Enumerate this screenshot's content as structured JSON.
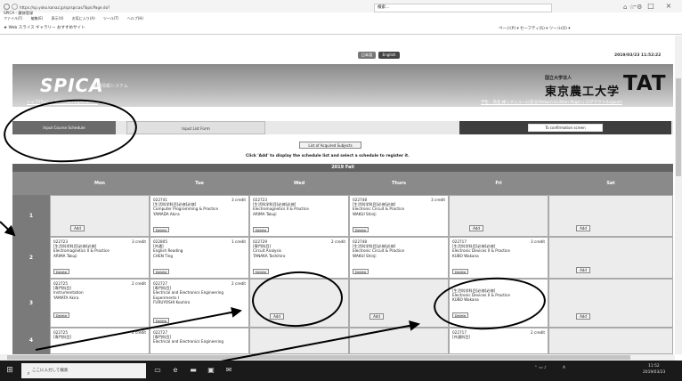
{
  "browser": {
    "url": "https://sp.yoko.kanaz.jp/sp/spicas/TopicPage.do?",
    "tab_title": "SPICA - 履修登録",
    "menu": [
      "ファイル(F)",
      "編集(E)",
      "表示(V)",
      "お気に入り(A)",
      "ツール(T)",
      "ヘルプ(H)"
    ],
    "favorites": [
      "Web スライス ギャラリー",
      "おすすめサイト"
    ],
    "search_placeholder": "検索...",
    "right_tools": "ページ(P) ▾  セーフティ(S) ▾  ツール(O) ▾"
  },
  "page": {
    "lang_jp": "日本語",
    "lang_en": "English",
    "datetime": "2019/03/23 11:52:22",
    "logo": "SPICA",
    "logo_sub": "学務情報システム",
    "uni_small": "国立大学法人",
    "uni_name": "東京農工大学",
    "uni_abbr": "TAT",
    "breadcrumb": "トップ(Top) > 履修登録(Registration)",
    "header_links": "学生 : 氏名 様 | メニューに戻る(Return to Main Page) | ログアウト(Logout)"
  },
  "tabs": {
    "input_schedule": "Input Course Schedule",
    "input_list": "Input List Form",
    "confirm": "To confirmation screen"
  },
  "buttons": {
    "list_subjects": "List of Acquired Subjects",
    "add": "Add",
    "delete": "Delete"
  },
  "instruction": "Click 'Add' to display the schedule list and select a schedule to register it.",
  "term": "2019 Fall",
  "days": [
    "Mon",
    "Tue",
    "Wed",
    "Thurs",
    "Fri",
    "Sat"
  ],
  "periods": [
    "1",
    "2",
    "3",
    "4"
  ],
  "courses": {
    "p1_tue": {
      "code": "022741",
      "credit": "3 credit",
      "req": "[生活科学科目]必修[必修]",
      "title": "Computer Programming & Practice",
      "teacher": "YAMADA Akira"
    },
    "p1_wed": {
      "code": "022723",
      "credit": "",
      "req": "[生活科学科目]必修[必修]",
      "title": "Electromagnetics II & Practice",
      "teacher": "ARIMA Takuji"
    },
    "p1_thu": {
      "code": "022748",
      "credit": "3 credit",
      "req": "[生活科学科目]必修[必修]",
      "title": "Electronic Circuit & Practice",
      "teacher": "WAKUI Shinji"
    },
    "p2_mon": {
      "code": "022723",
      "credit": "3 credit",
      "req": "[生活科学科目]必修[必修]",
      "title": "Electromagnetics II & Practice",
      "teacher": "ARIMA Takuji"
    },
    "p2_tue": {
      "code": "022805",
      "credit": "1 credit",
      "req": "[共通]",
      "title": "English Reading",
      "teacher": "CHEN Ting"
    },
    "p2_wed": {
      "code": "022729",
      "credit": "2 credit",
      "req": "[専門科目]",
      "title": "Circuit Analysis",
      "teacher": "TANAKA Toshihiro"
    },
    "p2_thu": {
      "code": "022748",
      "credit": "",
      "req": "[生活科学科目]必修[必修]",
      "title": "Electronic Circuit & Practice",
      "teacher": "WAKUI Shinji"
    },
    "p2_fri": {
      "code": "022717",
      "credit": "3 credit",
      "req": "[生活科学科目]必修[必修]",
      "title": "Electronic Devices II & Practice",
      "teacher": "KUBO Wakana"
    },
    "p3_mon": {
      "code": "022725",
      "credit": "2 credit",
      "req": "[専門科目]",
      "title": "Instrumentation",
      "teacher": "YAMATA Akira"
    },
    "p3_tue": {
      "code": "022727",
      "credit": "2 credit",
      "req": "[専門科目]",
      "title": "Electrical and Electronics Engineering Experiments I",
      "teacher": "FURUYOSHI Kouhiro"
    },
    "p3_fri": {
      "code": "022717",
      "credit": "",
      "req": "[生活科学科目]必修[必修]",
      "title": "Electronic Devices II & Practice",
      "teacher": "KUBO Wakana"
    },
    "p4_mon": {
      "code": "022725",
      "credit": "2 credit",
      "req": "[専門科目]",
      "title": "",
      "teacher": ""
    },
    "p4_tue": {
      "code": "022727",
      "credit": "",
      "req": "[専門科目]",
      "title": "Electrical and Electronics Engineering",
      "teacher": ""
    },
    "p4_fri": {
      "code": "022717",
      "credit": "2 credit",
      "req": "[共通科目]",
      "title": "",
      "teacher": ""
    }
  },
  "taskbar": {
    "search": "ここに入力して検索",
    "time": "11:52",
    "date": "2019/03/23",
    "ime": "A"
  }
}
